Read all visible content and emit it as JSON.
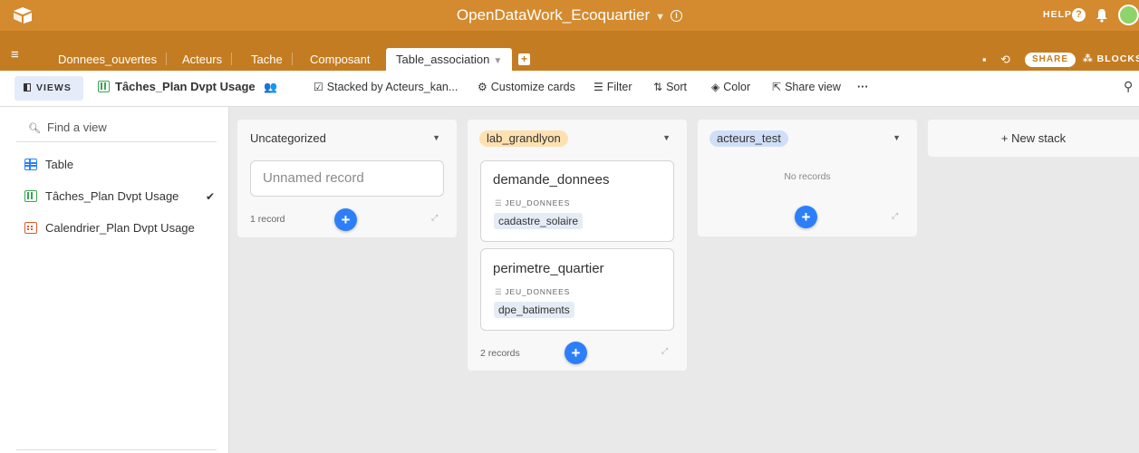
{
  "app": {
    "base_title": "OpenDataWork_Ecoquartier",
    "help_label": "HELP",
    "accent_color": "#d48a2e"
  },
  "tabs": [
    {
      "label": "Donnees_ouvertes"
    },
    {
      "label": "Acteurs"
    },
    {
      "label": "Tache"
    },
    {
      "label": "Composant"
    },
    {
      "label": "Table_association",
      "active": true
    }
  ],
  "topright": {
    "share_label": "SHARE",
    "blocks_label": "BLOCKS"
  },
  "viewbar": {
    "views_label": "VIEWS",
    "current_view": "Tâches_Plan Dvpt Usage",
    "stacked_by": "Stacked by Acteurs_kan...",
    "customize": "Customize cards",
    "filter": "Filter",
    "sort": "Sort",
    "color": "Color",
    "share_view": "Share view",
    "more": "···"
  },
  "sidebar": {
    "search_placeholder": "Find a view",
    "views": [
      {
        "label": "Table",
        "icon": "grid-view-icon"
      },
      {
        "label": "Tâches_Plan Dvpt Usage",
        "icon": "kanban-view-icon",
        "selected": true
      },
      {
        "label": "Calendrier_Plan Dvpt Usage",
        "icon": "calendar-view-icon"
      }
    ]
  },
  "kanban": {
    "stacks": [
      {
        "name": "Uncategorized",
        "cards": [
          {
            "title": "Unnamed record"
          }
        ],
        "record_count": "1 record"
      },
      {
        "name": "lab_grandlyon",
        "pill_color": "#fde1b0",
        "cards": [
          {
            "title": "demande_donnees",
            "field_label": "JEU_DONNEES",
            "field_value": "cadastre_solaire"
          },
          {
            "title": "perimetre_quartier",
            "field_label": "JEU_DONNEES",
            "field_value": "dpe_batiments"
          }
        ],
        "record_count": "2 records"
      },
      {
        "name": "acteurs_test",
        "pill_color": "#d0dff8",
        "empty_text": "No records"
      }
    ],
    "new_stack_label": "+ New stack"
  }
}
